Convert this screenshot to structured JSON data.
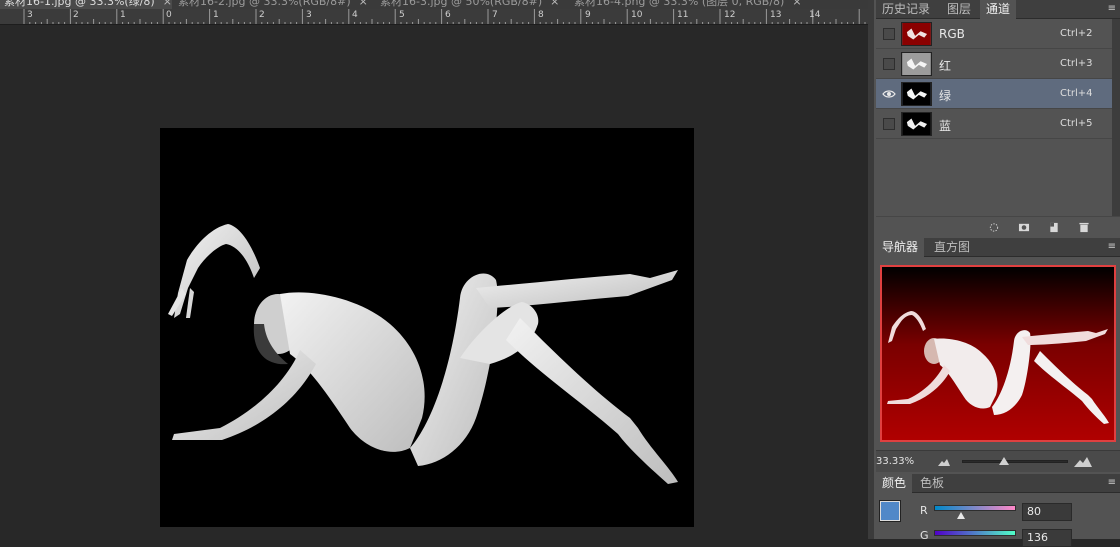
{
  "document_tabs": [
    {
      "label": "素材16-1.jpg @ 33.3%(绿/8)",
      "close": "×",
      "active": true
    },
    {
      "label": "素材16-2.jpg @ 33.3%(RGB/8#)",
      "close": "×",
      "active": false
    },
    {
      "label": "素材16-3.jpg @ 50%(RGB/8#)",
      "close": "×",
      "active": false
    },
    {
      "label": "素材16-4.png @ 33.3% (图层 0, RGB/8)",
      "close": "×",
      "active": false
    }
  ],
  "ruler": {
    "labels": [
      "3",
      "2",
      "1",
      "0",
      "1",
      "2",
      "3",
      "4",
      "5",
      "6",
      "7",
      "8",
      "9",
      "10",
      "11",
      "12",
      "13",
      "14"
    ]
  },
  "channels_panel": {
    "tabs": [
      "历史记录",
      "图层",
      "通道"
    ],
    "active_tab": "通道",
    "menu_icon": "panel-menu-icon",
    "channels": [
      {
        "name": "RGB",
        "shortcut": "Ctrl+2",
        "visible": false,
        "selected": false
      },
      {
        "name": "红",
        "shortcut": "Ctrl+3",
        "visible": false,
        "selected": false
      },
      {
        "name": "绿",
        "shortcut": "Ctrl+4",
        "visible": true,
        "selected": true
      },
      {
        "name": "蓝",
        "shortcut": "Ctrl+5",
        "visible": false,
        "selected": false
      }
    ],
    "footer_icons": [
      "load-selection-icon",
      "save-selection-icon",
      "new-channel-icon",
      "trash-icon"
    ]
  },
  "navigator_panel": {
    "tabs": [
      "导航器",
      "直方图"
    ],
    "active_tab": "导航器",
    "zoom": "33.33%"
  },
  "color_panel": {
    "tabs": [
      "颜色",
      "色板"
    ],
    "active_tab": "颜色",
    "foreground": "#5088c8",
    "sliders": [
      {
        "label": "R",
        "value": "80"
      },
      {
        "label": "G",
        "value": "136"
      }
    ]
  },
  "colors": {
    "accent_selected_row": "#5f6b7e",
    "navigator_frame": "#e04040",
    "navigator_bg": "#8a0000"
  }
}
